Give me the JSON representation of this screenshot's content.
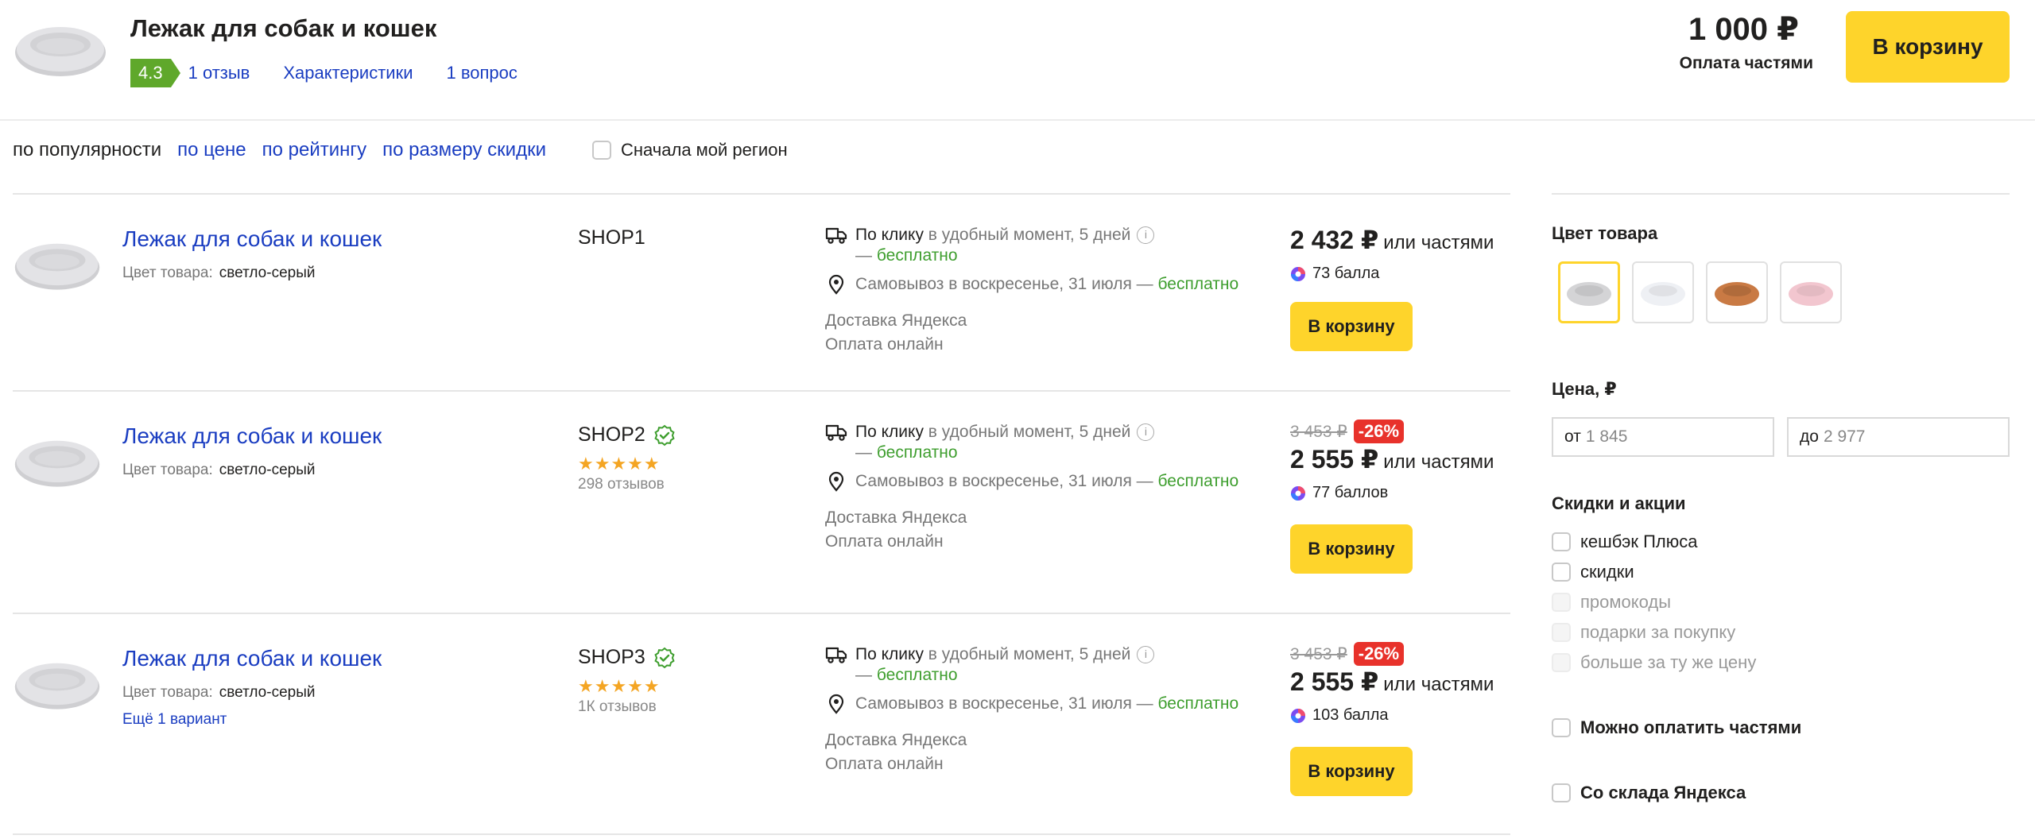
{
  "header": {
    "title": "Лежак для собак и кошек",
    "rating": "4.3",
    "links": [
      "1 отзыв",
      "Характеристики",
      "1 вопрос"
    ],
    "price": "1 000 ₽",
    "parts": "Оплата частями",
    "cart": "В корзину"
  },
  "sort": {
    "items": [
      "по популярности",
      "по цене",
      "по рейтингу",
      "по размеру скидки"
    ],
    "region": "Сначала мой регион"
  },
  "offers": [
    {
      "title": "Лежак для собак и кошек",
      "color_label": "Цвет товара:",
      "color_value": "светло-серый",
      "shop": "SHOP1",
      "delivery_1": "По клику",
      "delivery_1b": " в удобный момент, 5 дней",
      "delivery_free": "бесплатно",
      "pickup": "Самовывоз в воскресенье, 31 июля — ",
      "pickup_free": "бесплатно",
      "service": "Доставка Яндекса",
      "payment": "Оплата онлайн",
      "price": "2 432 ₽",
      "parts": "или частями",
      "bonus": "73 балла",
      "cart": "В корзину"
    },
    {
      "title": "Лежак для собак и кошек",
      "color_label": "Цвет товара:",
      "color_value": "светло-серый",
      "shop": "SHOP2",
      "stars": "★★★★★",
      "reviews": "298 отзывов",
      "delivery_1": "По клику",
      "delivery_1b": " в удобный момент, 5 дней",
      "delivery_free": "бесплатно",
      "pickup": "Самовывоз в воскресенье, 31 июля — ",
      "pickup_free": "бесплатно",
      "service": "Доставка Яндекса",
      "payment": "Оплата онлайн",
      "old_price": "3 453 ₽",
      "discount": "-26%",
      "price": "2 555 ₽",
      "parts": "или частями",
      "bonus": "77 баллов",
      "cart": "В корзину"
    },
    {
      "title": "Лежак для собак и кошек",
      "color_label": "Цвет товара:",
      "color_value": "светло-серый",
      "more": "Ещё 1 вариант",
      "shop": "SHOP3",
      "stars": "★★★★★",
      "reviews": "1К отзывов",
      "delivery_1": "По клику",
      "delivery_1b": " в удобный момент, 5 дней",
      "delivery_free": "бесплатно",
      "pickup": "Самовывоз в воскресенье, 31 июля — ",
      "pickup_free": "бесплатно",
      "service": "Доставка Яндекса",
      "payment": "Оплата онлайн",
      "old_price": "3 453 ₽",
      "discount": "-26%",
      "price": "2 555 ₽",
      "parts": "или частями",
      "bonus": "103 балла",
      "cart": "В корзину"
    }
  ],
  "sidebar": {
    "color_heading": "Цвет товара",
    "swatch_colors": [
      "#d4d4d6",
      "#eef0f4",
      "#c97a44",
      "#f2c6cf"
    ],
    "price_heading": "Цена, ₽",
    "price_from_label": "от",
    "price_from_placeholder": "1 845",
    "price_to_label": "до",
    "price_to_placeholder": "2 977",
    "discounts_heading": "Скидки и акции",
    "discounts": [
      "кешбэк Плюса",
      "скидки",
      "промокоды",
      "подарки за покупку",
      "больше за ту же цену"
    ],
    "installments": "Можно оплатить частями",
    "yandex_warehouse": "Со склада Яндекса"
  },
  "colors": {
    "accent_yellow": "#fed42b",
    "link_blue": "#1a3dc1",
    "rating_green": "#5fa82b",
    "discount_red": "#e8322b",
    "free_green": "#3e9e2e"
  }
}
